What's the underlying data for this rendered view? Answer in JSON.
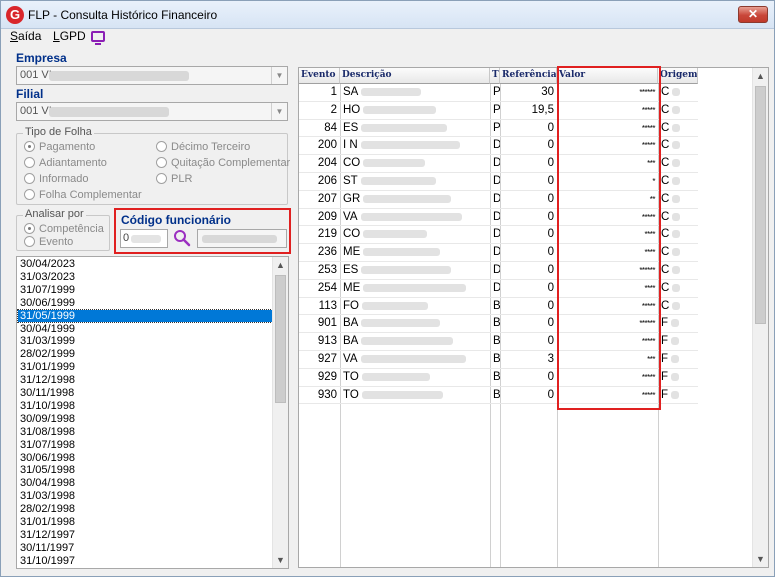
{
  "window": {
    "title": "FLP - Consulta Histórico Financeiro",
    "app_icon": "G",
    "close": "✕"
  },
  "menu": {
    "saida_accel": "S",
    "saida_rest": "aída",
    "lgpd_accel": "L",
    "lgpd_rest": "GPD",
    "lgpd_icon": "monitor-icon"
  },
  "empresa": {
    "label": "Empresa",
    "value": "001 VI"
  },
  "filial": {
    "label": "Filial",
    "value": "001 VI"
  },
  "tipo_folha": {
    "legend": "Tipo de Folha",
    "options": [
      "Pagamento",
      "Adiantamento",
      "Informado",
      "Folha Complementar",
      "Décimo Terceiro",
      "Quitação Complementar",
      "PLR"
    ],
    "selected": "Pagamento"
  },
  "analisar_por": {
    "legend": "Analisar por",
    "options": [
      "Competência",
      "Evento"
    ],
    "selected": "Competência"
  },
  "codigo": {
    "label": "Código funcionário",
    "value": "0"
  },
  "dates": {
    "selected": "31/05/1999",
    "items": [
      "30/04/2023",
      "31/03/2023",
      "31/07/1999",
      "30/06/1999",
      "31/05/1999",
      "30/04/1999",
      "31/03/1999",
      "28/02/1999",
      "31/01/1999",
      "31/12/1998",
      "30/11/1998",
      "31/10/1998",
      "30/09/1998",
      "31/08/1998",
      "31/07/1998",
      "30/06/1998",
      "31/05/1998",
      "30/04/1998",
      "31/03/1998",
      "28/02/1998",
      "31/01/1998",
      "31/12/1997",
      "30/11/1997",
      "31/10/1997"
    ]
  },
  "grid": {
    "columns": [
      "Evento",
      "Descrição",
      "T",
      "Referência",
      "Valor",
      "Origem"
    ],
    "rows": [
      {
        "evento": "1",
        "descricao": "SA",
        "tipo": "P",
        "referencia": "30",
        "valor": "******",
        "origem": "C"
      },
      {
        "evento": "2",
        "descricao": "HO",
        "tipo": "P",
        "referencia": "19,5",
        "valor": "*****",
        "origem": "C"
      },
      {
        "evento": "84",
        "descricao": "ES",
        "tipo": "P",
        "referencia": "0",
        "valor": "*****",
        "origem": "C"
      },
      {
        "evento": "200",
        "descricao": "I N",
        "tipo": "D",
        "referencia": "0",
        "valor": "*****",
        "origem": "C"
      },
      {
        "evento": "204",
        "descricao": "CO",
        "tipo": "D",
        "referencia": "0",
        "valor": "***",
        "origem": "C"
      },
      {
        "evento": "206",
        "descricao": "ST",
        "tipo": "D",
        "referencia": "0",
        "valor": "*",
        "origem": "C"
      },
      {
        "evento": "207",
        "descricao": "GR",
        "tipo": "D",
        "referencia": "0",
        "valor": "**",
        "origem": "C"
      },
      {
        "evento": "209",
        "descricao": "VA",
        "tipo": "D",
        "referencia": "0",
        "valor": "*****",
        "origem": "C"
      },
      {
        "evento": "219",
        "descricao": "CO",
        "tipo": "D",
        "referencia": "0",
        "valor": "****",
        "origem": "C"
      },
      {
        "evento": "236",
        "descricao": "ME",
        "tipo": "D",
        "referencia": "0",
        "valor": "****",
        "origem": "C"
      },
      {
        "evento": "253",
        "descricao": "ES",
        "tipo": "D",
        "referencia": "0",
        "valor": "******",
        "origem": "C"
      },
      {
        "evento": "254",
        "descricao": "ME",
        "tipo": "D",
        "referencia": "0",
        "valor": "****",
        "origem": "C"
      },
      {
        "evento": "113",
        "descricao": "FO",
        "tipo": "B",
        "referencia": "0",
        "valor": "*****",
        "origem": "C"
      },
      {
        "evento": "901",
        "descricao": "BA",
        "tipo": "B",
        "referencia": "0",
        "valor": "******",
        "origem": "F"
      },
      {
        "evento": "913",
        "descricao": "BA",
        "tipo": "B",
        "referencia": "0",
        "valor": "*****",
        "origem": "F"
      },
      {
        "evento": "927",
        "descricao": "VA",
        "tipo": "B",
        "referencia": "3",
        "valor": "***",
        "origem": "F"
      },
      {
        "evento": "929",
        "descricao": "TO",
        "tipo": "B",
        "referencia": "0",
        "valor": "*****",
        "origem": "F"
      },
      {
        "evento": "930",
        "descricao": "TO",
        "tipo": "B",
        "referencia": "0",
        "valor": "*****",
        "origem": "F"
      }
    ]
  }
}
